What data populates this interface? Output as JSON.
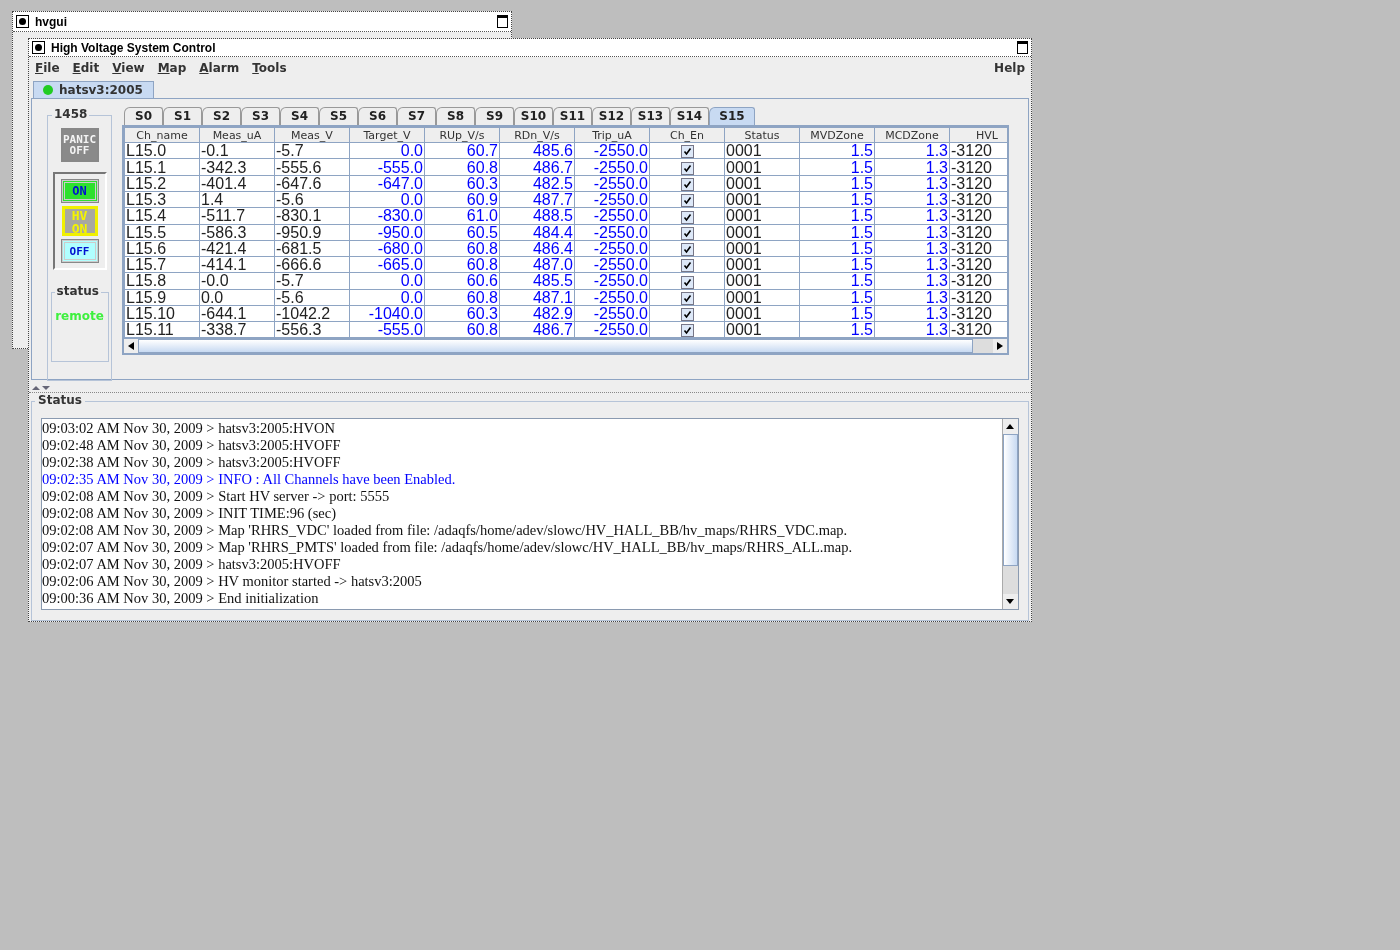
{
  "back_window": {
    "title": "hvgui"
  },
  "window": {
    "title": "High Voltage System Control"
  },
  "menus": [
    {
      "label": "File"
    },
    {
      "label": "Edit"
    },
    {
      "label": "View"
    },
    {
      "label": "Map"
    },
    {
      "label": "Alarm"
    },
    {
      "label": "Tools"
    }
  ],
  "help_menu": {
    "label": "Help"
  },
  "host_tabs": [
    {
      "label": "hatsv3:2005",
      "selected": true,
      "color": "#22cc22"
    }
  ],
  "crate": {
    "title": "1458",
    "buttons": [
      {
        "kind": "panic",
        "label": "PANIC OFF"
      },
      {
        "kind": "on",
        "label": "ON"
      },
      {
        "kind": "hvon",
        "label": "HV ON"
      },
      {
        "kind": "off",
        "label": "OFF"
      }
    ],
    "status_title": "status",
    "status_value": "remote"
  },
  "slot_tabs": [
    {
      "label": "S0",
      "selected": false
    },
    {
      "label": "S1",
      "selected": false
    },
    {
      "label": "S2",
      "selected": false
    },
    {
      "label": "S3",
      "selected": false
    },
    {
      "label": "S4",
      "selected": false
    },
    {
      "label": "S5",
      "selected": false
    },
    {
      "label": "S6",
      "selected": false
    },
    {
      "label": "S7",
      "selected": false
    },
    {
      "label": "S8",
      "selected": false
    },
    {
      "label": "S9",
      "selected": false
    },
    {
      "label": "S10",
      "selected": false
    },
    {
      "label": "S11",
      "selected": false
    },
    {
      "label": "S12",
      "selected": false
    },
    {
      "label": "S13",
      "selected": false
    },
    {
      "label": "S14",
      "selected": false
    },
    {
      "label": "S15",
      "selected": true
    }
  ],
  "table": {
    "columns": [
      {
        "label": "Ch_name",
        "kind": "text"
      },
      {
        "label": "Meas_uA",
        "kind": "text"
      },
      {
        "label": "Meas_V",
        "kind": "text"
      },
      {
        "label": "Target_V",
        "kind": "edit"
      },
      {
        "label": "RUp_V/s",
        "kind": "edit"
      },
      {
        "label": "RDn_V/s",
        "kind": "edit"
      },
      {
        "label": "Trip_uA",
        "kind": "edit"
      },
      {
        "label": "Ch_En",
        "kind": "check"
      },
      {
        "label": "Status",
        "kind": "text"
      },
      {
        "label": "MVDZone",
        "kind": "edit"
      },
      {
        "label": "MCDZone",
        "kind": "edit"
      },
      {
        "label": "HVL",
        "kind": "text"
      }
    ],
    "rows": [
      {
        "cells": [
          "L15.0",
          "-0.1",
          "-5.7",
          "0.0",
          "60.7",
          "485.6",
          "-2550.0",
          "",
          "0001",
          "1.5",
          "1.3",
          "-3120"
        ],
        "checked": true
      },
      {
        "cells": [
          "L15.1",
          "-342.3",
          "-555.6",
          "-555.0",
          "60.8",
          "486.7",
          "-2550.0",
          "",
          "0001",
          "1.5",
          "1.3",
          "-3120"
        ],
        "checked": true
      },
      {
        "cells": [
          "L15.2",
          "-401.4",
          "-647.6",
          "-647.0",
          "60.3",
          "482.5",
          "-2550.0",
          "",
          "0001",
          "1.5",
          "1.3",
          "-3120"
        ],
        "checked": true
      },
      {
        "cells": [
          "L15.3",
          "1.4",
          "-5.6",
          "0.0",
          "60.9",
          "487.7",
          "-2550.0",
          "",
          "0001",
          "1.5",
          "1.3",
          "-3120"
        ],
        "checked": true
      },
      {
        "cells": [
          "L15.4",
          "-511.7",
          "-830.1",
          "-830.0",
          "61.0",
          "488.5",
          "-2550.0",
          "",
          "0001",
          "1.5",
          "1.3",
          "-3120"
        ],
        "checked": true
      },
      {
        "cells": [
          "L15.5",
          "-586.3",
          "-950.9",
          "-950.0",
          "60.5",
          "484.4",
          "-2550.0",
          "",
          "0001",
          "1.5",
          "1.3",
          "-3120"
        ],
        "checked": true
      },
      {
        "cells": [
          "L15.6",
          "-421.4",
          "-681.5",
          "-680.0",
          "60.8",
          "486.4",
          "-2550.0",
          "",
          "0001",
          "1.5",
          "1.3",
          "-3120"
        ],
        "checked": true
      },
      {
        "cells": [
          "L15.7",
          "-414.1",
          "-666.6",
          "-665.0",
          "60.8",
          "487.0",
          "-2550.0",
          "",
          "0001",
          "1.5",
          "1.3",
          "-3120"
        ],
        "checked": true
      },
      {
        "cells": [
          "L15.8",
          "-0.0",
          "-5.7",
          "0.0",
          "60.6",
          "485.5",
          "-2550.0",
          "",
          "0001",
          "1.5",
          "1.3",
          "-3120"
        ],
        "checked": true
      },
      {
        "cells": [
          "L15.9",
          "0.0",
          "-5.6",
          "0.0",
          "60.8",
          "487.1",
          "-2550.0",
          "",
          "0001",
          "1.5",
          "1.3",
          "-3120"
        ],
        "checked": true
      },
      {
        "cells": [
          "L15.10",
          "-644.1",
          "-1042.2",
          "-1040.0",
          "60.3",
          "482.9",
          "-2550.0",
          "",
          "0001",
          "1.5",
          "1.3",
          "-3120"
        ],
        "checked": true
      },
      {
        "cells": [
          "L15.11",
          "-338.7",
          "-556.3",
          "-555.0",
          "60.8",
          "486.7",
          "-2550.0",
          "",
          "0001",
          "1.5",
          "1.3",
          "-3120"
        ],
        "checked": true
      }
    ]
  },
  "log": {
    "title": "Status",
    "entries": [
      {
        "text": "09:03:02 AM Nov 30, 2009 > hatsv3:2005:HVON",
        "kind": "normal"
      },
      {
        "text": "09:02:48 AM Nov 30, 2009 > hatsv3:2005:HVOFF",
        "kind": "normal"
      },
      {
        "text": "09:02:38 AM Nov 30, 2009 > hatsv3:2005:HVOFF",
        "kind": "normal"
      },
      {
        "text": "09:02:35 AM Nov 30, 2009 > INFO : All Channels have been Enabled.",
        "kind": "info"
      },
      {
        "text": "09:02:08 AM Nov 30, 2009 > Start HV server -> port: 5555",
        "kind": "normal"
      },
      {
        "text": "09:02:08 AM Nov 30, 2009 > INIT TIME:96 (sec)",
        "kind": "normal"
      },
      {
        "text": "09:02:08 AM Nov 30, 2009 > Map 'RHRS_VDC' loaded from file: /adaqfs/home/adev/slowc/HV_HALL_BB/hv_maps/RHRS_VDC.map.",
        "kind": "normal"
      },
      {
        "text": "09:02:07 AM Nov 30, 2009 > Map 'RHRS_PMTS' loaded from file: /adaqfs/home/adev/slowc/HV_HALL_BB/hv_maps/RHRS_ALL.map.",
        "kind": "normal"
      },
      {
        "text": "09:02:07 AM Nov 30, 2009 > hatsv3:2005:HVOFF",
        "kind": "normal"
      },
      {
        "text": "09:02:06 AM Nov 30, 2009 > HV monitor started -> hatsv3:2005",
        "kind": "normal"
      },
      {
        "text": "09:00:36 AM Nov 30, 2009 > End initialization",
        "kind": "normal"
      }
    ]
  }
}
